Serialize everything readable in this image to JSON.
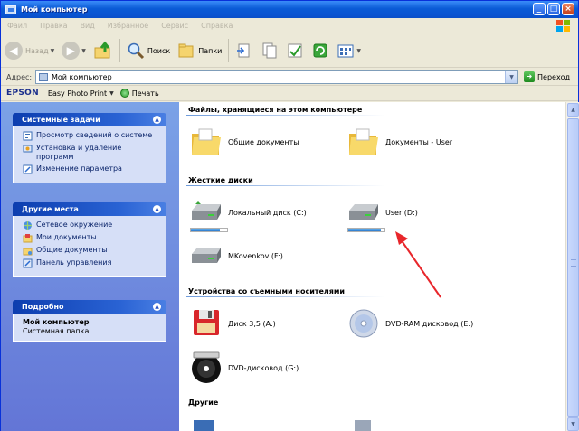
{
  "window": {
    "title": "Мой компьютер"
  },
  "menu": [
    "Файл",
    "Правка",
    "Вид",
    "Избранное",
    "Сервис",
    "Справка"
  ],
  "toolbar": {
    "back_label": "Назад",
    "search_label": "Поиск",
    "folders_label": "Папки"
  },
  "address": {
    "label": "Адрес:",
    "value": "Мой компьютер",
    "go_label": "Переход"
  },
  "epson": {
    "brand": "EPSON",
    "app": "Easy Photo Print",
    "print_label": "Печать"
  },
  "tasks": {
    "system": {
      "title": "Системные задачи",
      "items": [
        "Просмотр сведений о системе",
        "Установка и удаление программ",
        "Изменение параметра"
      ]
    },
    "places": {
      "title": "Другие места",
      "items": [
        "Сетевое окружение",
        "Мои документы",
        "Общие документы",
        "Панель управления"
      ]
    },
    "details": {
      "title": "Подробно",
      "name": "Мой компьютер",
      "type": "Системная папка"
    }
  },
  "groups": {
    "files": {
      "title": "Файлы, хранящиеся на этом компьютере",
      "items": [
        "Общие документы",
        "Документы - User"
      ]
    },
    "disks": {
      "title": "Жесткие диски",
      "items": [
        {
          "label": "Локальный диск (C:)",
          "used": 0.8
        },
        {
          "label": "User (D:)",
          "used": 0.9
        },
        {
          "label": "MKovenkov (F:)"
        }
      ]
    },
    "removable": {
      "title": "Устройства со съемными носителями",
      "items": [
        "Диск 3,5 (A:)",
        "DVD-RAM дисковод (E:)",
        "DVD-дисковод (G:)"
      ]
    },
    "other": {
      "title": "Другие"
    }
  },
  "colors": {
    "titlebar": "#0a5bd6",
    "taskpane": "#7ba2e7",
    "annotation": "#e8262b"
  }
}
